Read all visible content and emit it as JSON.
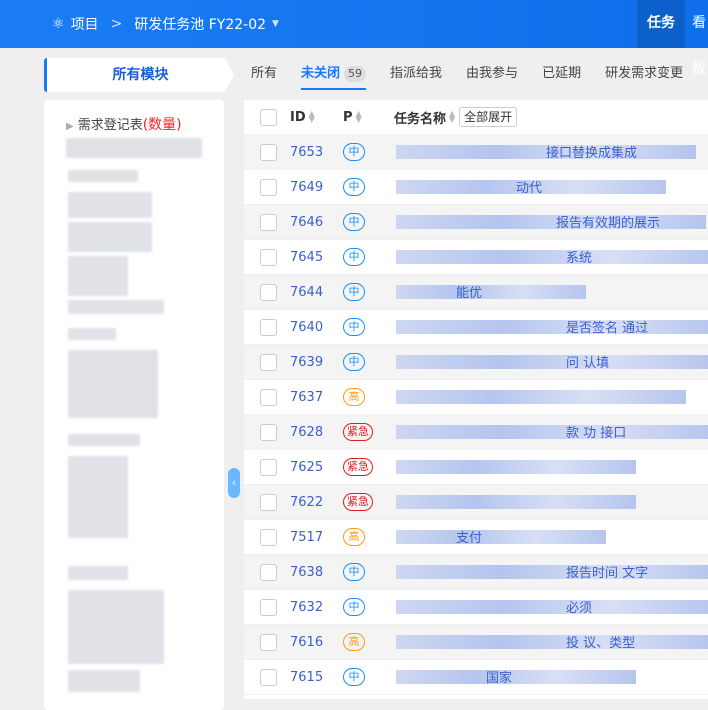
{
  "topbar": {
    "crumb_root": "项目",
    "crumb_current": "研发任务池 FY22-02",
    "nav": [
      "任务",
      "看板"
    ]
  },
  "module_tab": "所有模块",
  "filters": [
    {
      "label": "所有"
    },
    {
      "label": "未关闭",
      "count": "59"
    },
    {
      "label": "指派给我"
    },
    {
      "label": "由我参与"
    },
    {
      "label": "已延期"
    },
    {
      "label": "研发需求变更"
    }
  ],
  "sidebar": {
    "first_item": "需求登记表",
    "first_count": "(数量)"
  },
  "table": {
    "headers": {
      "id": "ID",
      "p": "P",
      "task": "任务名称",
      "expand_all": "全部展开"
    },
    "rows": [
      {
        "id": "7653",
        "p": "中",
        "frag": "接口替换成集成"
      },
      {
        "id": "7649",
        "p": "中",
        "frag": "动代"
      },
      {
        "id": "7646",
        "p": "中",
        "frag": "报告有效期的展示"
      },
      {
        "id": "7645",
        "p": "中",
        "frag": "系统"
      },
      {
        "id": "7644",
        "p": "中",
        "frag": "能优"
      },
      {
        "id": "7640",
        "p": "中",
        "frag": "是否签名 通过"
      },
      {
        "id": "7639",
        "p": "中",
        "frag": "问 认填"
      },
      {
        "id": "7637",
        "p": "高",
        "frag": ""
      },
      {
        "id": "7628",
        "p": "紧急",
        "frag": "款 功 接口"
      },
      {
        "id": "7625",
        "p": "紧急",
        "frag": ""
      },
      {
        "id": "7622",
        "p": "紧急",
        "frag": ""
      },
      {
        "id": "7517",
        "p": "高",
        "frag": "支付"
      },
      {
        "id": "7638",
        "p": "中",
        "frag": "报告时间 文字"
      },
      {
        "id": "7632",
        "p": "中",
        "frag": "必须"
      },
      {
        "id": "7616",
        "p": "高",
        "frag": "投 议、类型"
      },
      {
        "id": "7615",
        "p": "中",
        "frag": "国家"
      }
    ]
  }
}
